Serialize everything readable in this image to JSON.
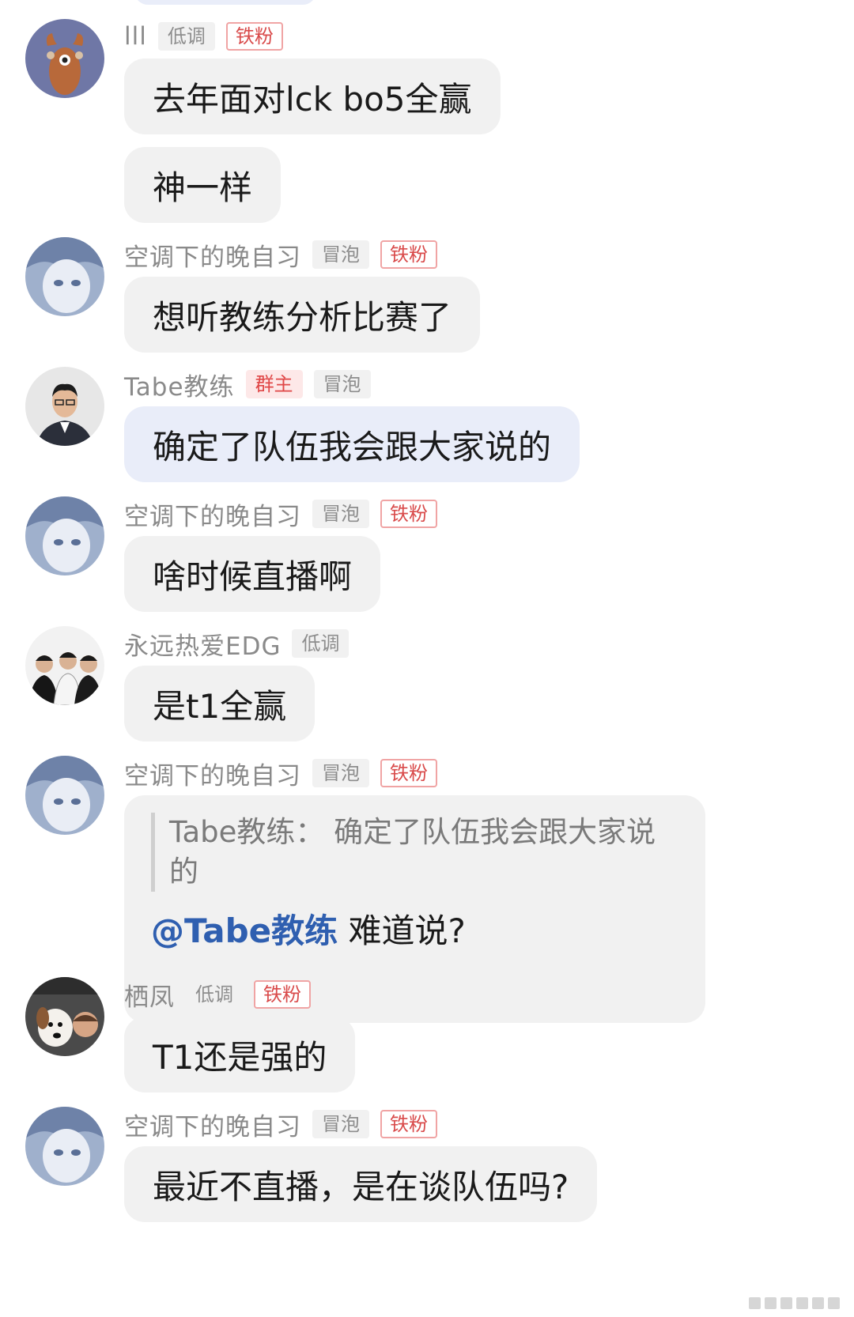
{
  "messages": [
    {
      "user": "lll",
      "tags": [
        {
          "text": "低调",
          "style": "gray"
        },
        {
          "text": "铁粉",
          "style": "fan"
        }
      ],
      "bubbles": [
        "去年面对lck bo5全赢",
        "神一样"
      ],
      "avatar": "deer-avatar"
    },
    {
      "user": "空调下的晚自习",
      "tags": [
        {
          "text": "冒泡",
          "style": "gray"
        },
        {
          "text": "铁粉",
          "style": "fan"
        }
      ],
      "bubbles": [
        "想听教练分析比赛了"
      ],
      "avatar": "anime-avatar"
    },
    {
      "user": "Tabe教练",
      "tags": [
        {
          "text": "群主",
          "style": "owner"
        },
        {
          "text": "冒泡",
          "style": "gray"
        }
      ],
      "bubbles": [
        "确定了队伍我会跟大家说的"
      ],
      "avatar": "coach-avatar"
    },
    {
      "user": "空调下的晚自习",
      "tags": [
        {
          "text": "冒泡",
          "style": "gray"
        },
        {
          "text": "铁粉",
          "style": "fan"
        }
      ],
      "bubbles": [
        "啥时候直播啊"
      ],
      "avatar": "anime-avatar"
    },
    {
      "user": "永远热爱EDG",
      "tags": [
        {
          "text": "低调",
          "style": "gray"
        }
      ],
      "bubbles": [
        "是t1全赢"
      ],
      "avatar": "team-photo-avatar"
    },
    {
      "user": "空调下的晚自习",
      "tags": [
        {
          "text": "冒泡",
          "style": "gray"
        },
        {
          "text": "铁粉",
          "style": "fan"
        }
      ],
      "quote": "Tabe教练：  确定了队伍我会跟大家说的",
      "mention": "@Tabe教练",
      "reply": " 难道说?",
      "avatar": "anime-avatar"
    },
    {
      "user": "栖凤",
      "tags": [
        {
          "text": "低调",
          "style": "gray"
        },
        {
          "text": "铁粉",
          "style": "fan"
        }
      ],
      "bubbles": [
        "T1还是强的"
      ],
      "avatar": "dog-avatar"
    },
    {
      "user": "空调下的晚自习",
      "tags": [
        {
          "text": "冒泡",
          "style": "gray"
        },
        {
          "text": "铁粉",
          "style": "fan"
        }
      ],
      "bubbles": [
        "最近不直播，是在谈队伍吗?"
      ],
      "avatar": "anime-avatar"
    }
  ],
  "colors": {
    "bubble": "#f1f1f1",
    "owner_bubble": "#e9edf9",
    "mention": "#2f5fb0",
    "fan_tag": "#d94b4b"
  }
}
